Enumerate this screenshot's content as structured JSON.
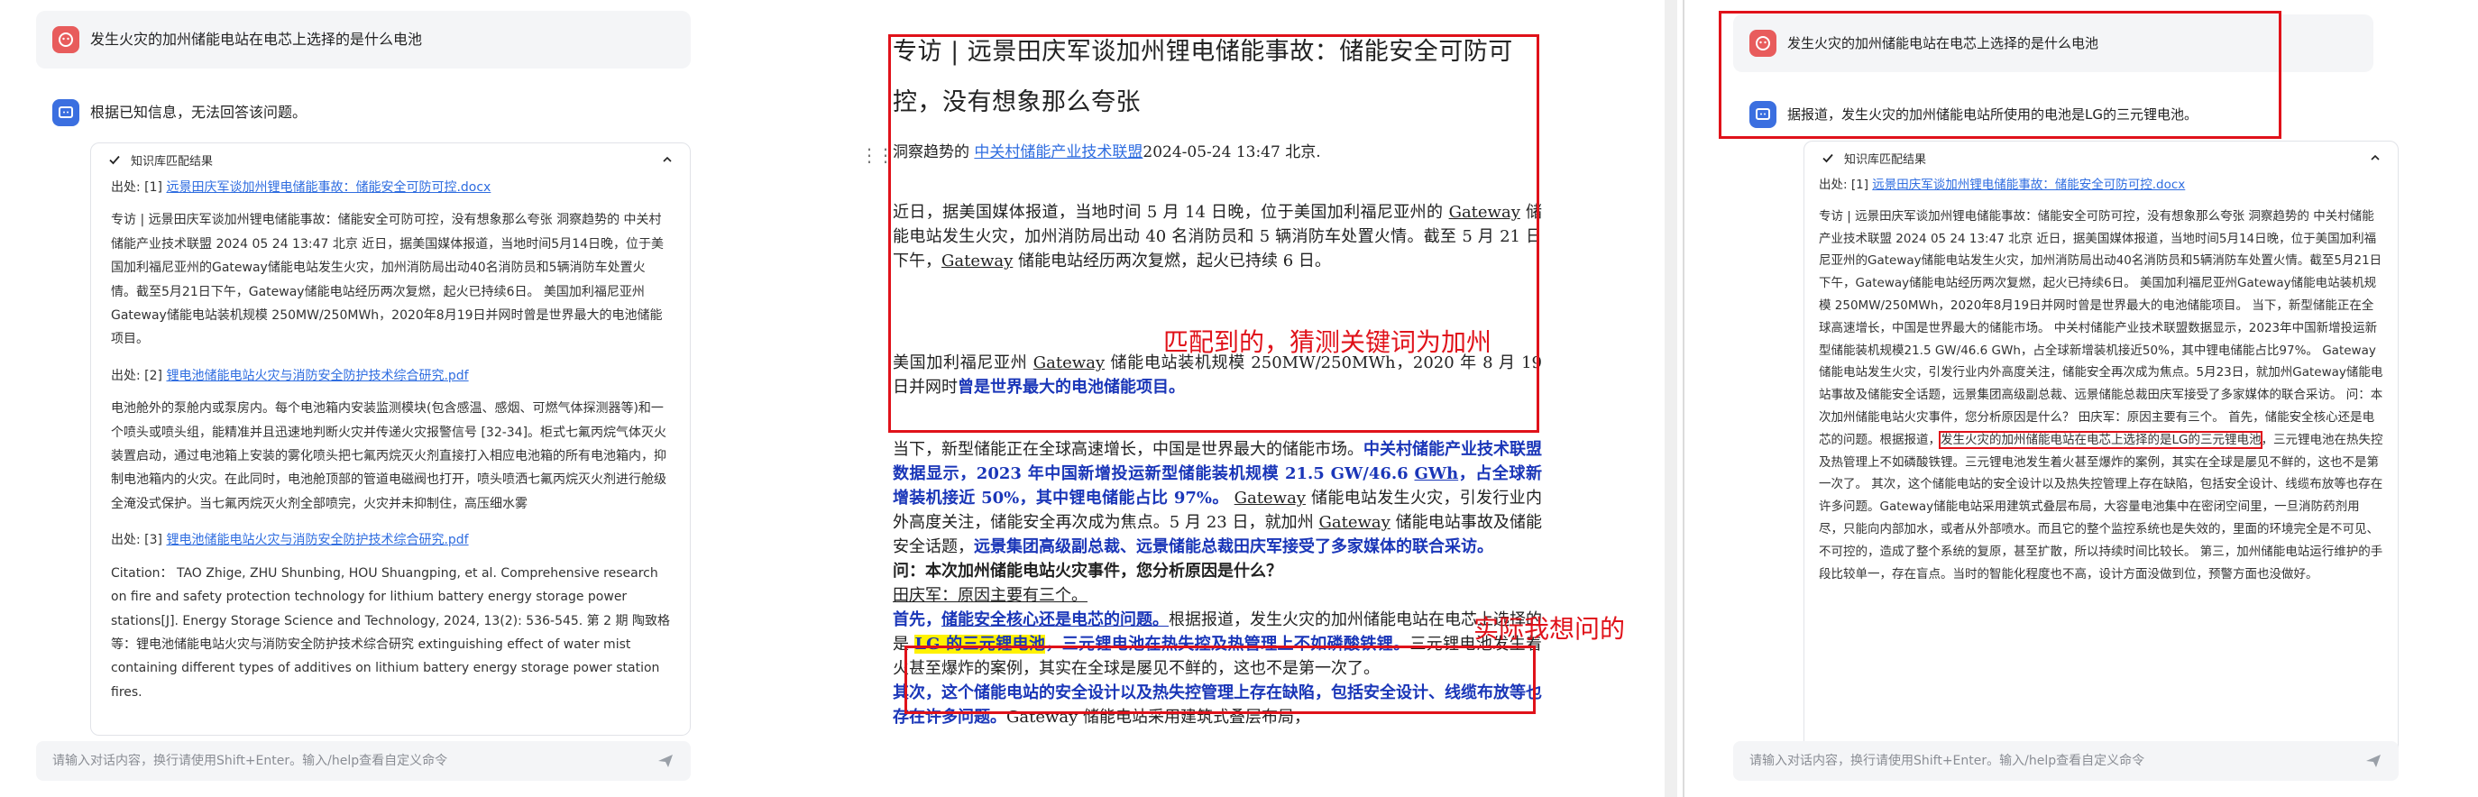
{
  "left_panel": {
    "question": "发生火灾的加州储能电站在电芯上选择的是什么电池",
    "answer": "根据已知信息，无法回答该问题。",
    "kb": {
      "header": "知识库匹配结果",
      "items": [
        {
          "src_prefix": "出处: [1] ",
          "src_link": "远景田庆军谈加州锂电储能事故：储能安全可防可控.docx",
          "text": "专访 | 远景田庆军谈加州锂电储能事故：储能安全可防可控，没有想象那么夸张 洞察趋势的 中关村储能产业技术联盟 2024 05 24 13:47 北京 近日，据美国媒体报道，当地时间5月14日晚，位于美国加利福尼亚州的Gateway储能电站发生火灾，加州消防局出动40名消防员和5辆消防车处置火情。截至5月21日下午，Gateway储能电站经历两次复燃，起火已持续6日。 美国加利福尼亚州Gateway储能电站装机规模 250MW/250MWh，2020年8月19日并网时曾是世界最大的电池储能项目。"
        },
        {
          "src_prefix": "出处: [2] ",
          "src_link": "锂电池储能电站火灾与消防安全防护技术综合研究.pdf",
          "text": "电池舱外的泵舱内或泵房内。每个电池箱内安装监测模块(包含感温、感烟、可燃气体探测器等)和一个喷头或喷头组，能精准并且迅速地判断火灾并传递火灾报警信号 [32-34]。柜式七氟丙烷气体灭火装置启动，通过电池箱上安装的雾化喷头把七氟丙烷灭火剂直接打入相应电池箱的所有电池箱内，抑制电池箱内的火灾。在此同时，电池舱顶部的管道电磁阀也打开，喷头喷洒七氟丙烷灭火剂进行舱级全淹没式保护。当七氟丙烷灭火剂全部喷完，火灾并未抑制住，高压细水雾"
        },
        {
          "src_prefix": "出处: [3] ",
          "src_link": "锂电池储能电站火灾与消防安全防护技术综合研究.pdf",
          "text": "Citation： TAO Zhige, ZHU Shunbing, HOU Shuangping, et al. Comprehensive research on fire and safety protection technology for lithium battery energy storage power stations[J]. Energy Storage Science and Technology, 2024, 13(2): 536-545. 第 2 期 陶致格等：锂电池储能电站火灾与消防安全防护技术综合研究 extinguishing effect of water mist containing different types of additives on lithium battery energy storage power station fires."
        }
      ]
    },
    "input_placeholder": "请输入对话内容，换行请使用Shift+Enter。输入/help查看自定义命令"
  },
  "document": {
    "title": "专访 | 远景田庆军谈加州锂电储能事故：储能安全可防可控，没有想象那么夸张",
    "meta_prefix": "洞察趋势的 ",
    "meta_link": "中关村储能产业技术联盟",
    "meta_date": "2024-05-24 13:47",
    "meta_loc": " 北京.",
    "p1": {
      "a": "近日，据美国媒体报道，当地时间 5 月 14 日晚，位于美国加利福尼亚州的 ",
      "b": "Gateway",
      "c": " 储能电站发生火灾，加州消防局出动 40 名消防员和 5 辆消防车处置火情。截至 5 月 21 日下午，",
      "d": "Gateway",
      "e": " 储能电站经历两次复燃，起火已持续 6 日。"
    },
    "p2": {
      "a": "美国加利福尼亚州 ",
      "b": "Gateway",
      "c": " 储能电站装机规模 250MW/250MWh，2020 年 8 月 19 日并网时",
      "d": "曾是世界最大的电池储能项目。"
    },
    "p3": {
      "a": "当下，新型储能正在全球高速增长，中国是世界最大的储能市场。",
      "b": "中关村储能产业技术联盟数据显示，2023 年中国新增投运新型储能装机规模 21.5 GW/46.6 ",
      "c": "GWh",
      "d": "，占全球新增装机接近 50%，其中锂电储能占比 97%。",
      "e": "Gateway",
      "f": " 储能电站发生火灾，引发行业内外高度关注，储能安全再次成为焦点。5 月 23 日，就加州 ",
      "g": "Gateway",
      "h": " 储能电站事故及储能安全话题，",
      "i": "远景集团高级副总裁、远景储能总裁田庆军接受了多家媒体的联合采访。",
      "q": "问：本次加州储能电站火灾事件，您分析原因是什么？",
      "ans": "田庆军：原因主要有三个。"
    },
    "p4": {
      "a": "首先，",
      "b": "储能安全核心还是电芯的问题。",
      "c": "根据报道，发生火灾的加州储能电站在电芯上选择的是 ",
      "d": "LG 的三元锂电池",
      "e": "，",
      "f": "三元锂电池在热失控及热管理上不如磷酸铁锂。",
      "g": "三元锂电池发生着火甚至爆炸的案例，其实在全球是屡见不鲜的，这也不是第一次了。"
    },
    "p5": {
      "a": "其次，这个储能电站的安全设计以及热失控管理上存在缺陷，包括安全设计、线缆布放等也存在许多问题。",
      "b": "Gateway 储能电站采用建筑式叠层布局，"
    }
  },
  "annotations": {
    "matched": "匹配到的，猜测关键词为加州",
    "actual": "实际我想问的"
  },
  "right_panel": {
    "question": "发生火灾的加州储能电站在电芯上选择的是什么电池",
    "answer": "据报道，发生火灾的加州储能电站所使用的电池是LG的三元锂电池。",
    "kb": {
      "header": "知识库匹配结果",
      "src_prefix": "出处: [1] ",
      "src_link": "远景田庆军谈加州锂电储能事故：储能安全可防可控.docx",
      "text_before": "专访 | 远景田庆军谈加州锂电储能事故：储能安全可防可控，没有想象那么夸张 洞察趋势的 中关村储能产业技术联盟 2024 05 24 13:47 北京 近日，据美国媒体报道，当地时间5月14日晚，位于美国加利福尼亚州的Gateway储能电站发生火灾，加州消防局出动40名消防员和5辆消防车处置火情。截至5月21日下午，Gateway储能电站经历两次复燃，起火已持续6日。 美国加利福尼亚州Gateway储能电站装机规模 250MW/250MWh，2020年8月19日并网时曾是世界最大的电池储能项目。 当下，新型储能正在全球高速增长，中国是世界最大的储能市场。 中关村储能产业技术联盟数据显示，2023年中国新增投运新型储能装机规模21.5 GW/46.6 GWh，占全球新增装机接近50%，其中锂电储能占比97%。 Gateway储能电站发生火灾，引发行业内外高度关注，储能安全再次成为焦点。5月23日，就加州Gateway储能电站事故及储能安全话题，远景集团高级副总裁、远景储能总裁田庆军接受了多家媒体的联合采访。 问：本次加州储能电站火灾事件，您分析原因是什么？ 田庆军：原因主要有三个。 首先，储能安全核心还是电芯的问题。根据报道，",
      "highlight": "发生火灾的加州储能电站在电芯上选择的是LG的三元锂电池",
      "text_after": "，三元锂电池在热失控及热管理上不如磷酸铁锂。三元锂电池发生着火甚至爆炸的案例，其实在全球是屡见不鲜的，这也不是第一次了。 其次，这个储能电站的安全设计以及热失控管理上存在缺陷，包括安全设计、线缆布放等也存在许多问题。Gateway储能电站采用建筑式叠层布局，大容量电池集中在密闭空间里，一旦消防药剂用尽，只能向内部加水，或者从外部喷水。而且它的整个监控系统也是失效的，里面的环境完全是不可见、不可控的，造成了整个系统的复原，甚至扩散，所以持续时间比较长。 第三，加州储能电站运行维护的手段比较单一，存在盲点。当时的智能化程度也不高，设计方面没做到位，预警方面也没做好。"
    },
    "input_placeholder": "请输入对话内容，换行请使用Shift+Enter。输入/help查看自定义命令"
  }
}
